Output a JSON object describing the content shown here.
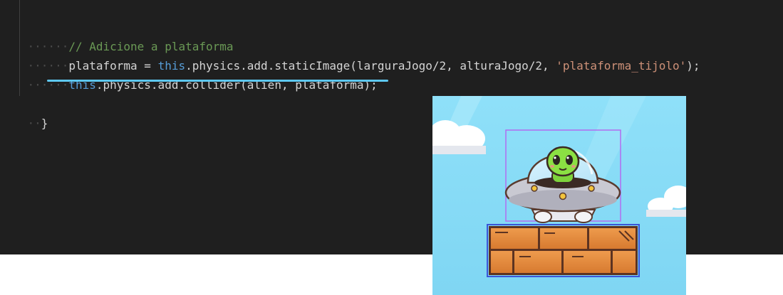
{
  "editor": {
    "background": "#1f1f1f",
    "lines": [
      {
        "indent": "······",
        "tokens": [
          {
            "text": "// Adicione a plataforma",
            "kind": "comment"
          }
        ]
      },
      {
        "indent": "······",
        "tokens": [
          {
            "text": "plataforma = ",
            "kind": "plain"
          },
          {
            "text": "this",
            "kind": "keyword"
          },
          {
            "text": ".physics.add.staticImage(larguraJogo/2, alturaJogo/2, ",
            "kind": "plain"
          },
          {
            "text": "'plataforma_tijolo'",
            "kind": "string"
          },
          {
            "text": ");",
            "kind": "plain"
          }
        ]
      },
      {
        "indent": "······",
        "tokens": [
          {
            "text": "this",
            "kind": "keyword"
          },
          {
            "text": ".physics.add.collider(alien, plataforma);",
            "kind": "plain"
          }
        ]
      },
      {
        "indent": "",
        "tokens": []
      },
      {
        "indent": "··",
        "tokens": [
          {
            "text": "}",
            "kind": "plain"
          }
        ]
      }
    ],
    "highlight_color": "#5ec8f2",
    "colors": {
      "comment": "#6a9955",
      "keyword": "#569cd6",
      "string": "#ce9178",
      "plain": "#d4d4d4"
    }
  },
  "game_preview": {
    "sky_color": "#86dcf7",
    "alien_hitbox_color": "#b26cf0",
    "platform_hitbox_color": "#3a56d8",
    "sprites": [
      "ufo-alien-icon",
      "brick-platform-icon",
      "cloud-icon"
    ]
  }
}
